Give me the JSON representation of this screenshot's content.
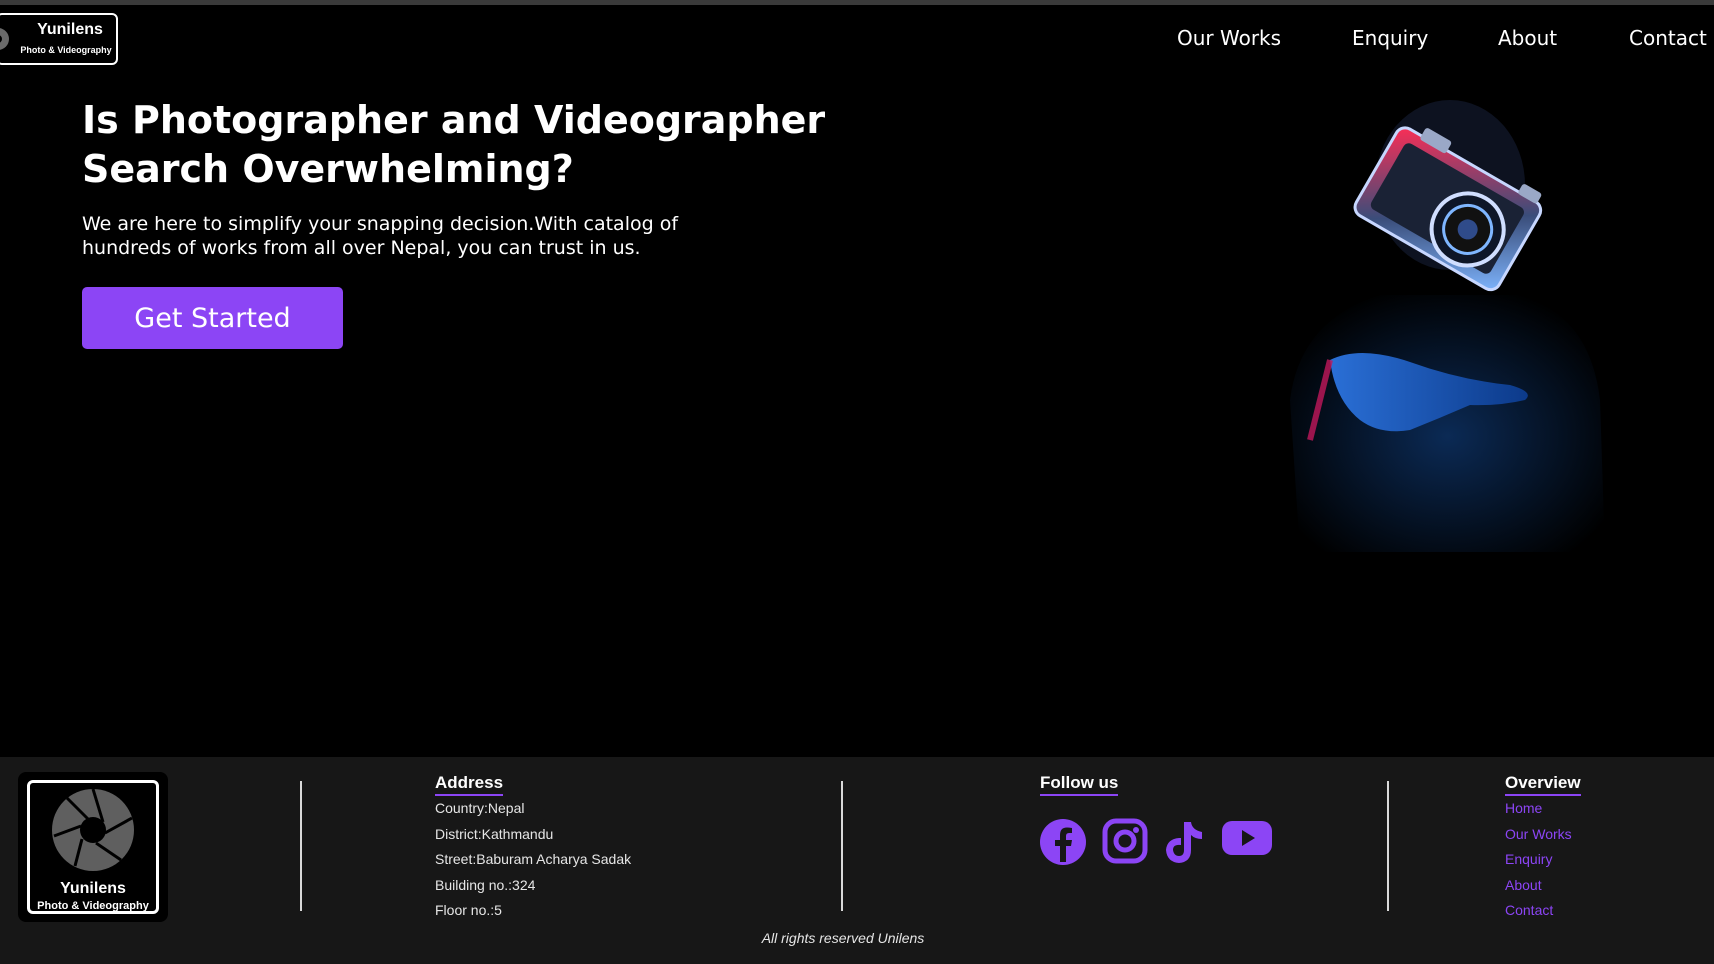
{
  "brand": {
    "name": "Yunilens",
    "tagline": "Photo & Videography"
  },
  "nav": {
    "items": [
      {
        "label": "Our Works"
      },
      {
        "label": "Enquiry"
      },
      {
        "label": "About"
      },
      {
        "label": "Contact"
      }
    ]
  },
  "hero": {
    "title": "Is Photographer and Videographer Search Overwhelming?",
    "text": "We are here to simplify your snapping decision.With catalog of hundreds of works from all over Nepal, you can trust in us.",
    "cta_label": "Get Started",
    "image_alt": "Person holding a floating vintage camera in neon light"
  },
  "footer": {
    "address": {
      "title": "Address",
      "lines": [
        "Country:Nepal",
        "District:Kathmandu",
        "Street:Baburam Acharya Sadak",
        "Building no.:324",
        "Floor no.:5"
      ]
    },
    "follow": {
      "title": "Follow us",
      "icons": [
        "facebook-icon",
        "instagram-icon",
        "tiktok-icon",
        "youtube-icon"
      ]
    },
    "overview": {
      "title": "Overview",
      "links": [
        "Home",
        "Our Works",
        "Enquiry",
        "About",
        "Contact"
      ]
    },
    "copyright": "All rights reserved Unilens"
  },
  "colors": {
    "accent": "#8c45f5",
    "background": "#000000",
    "footer_bg": "#171717"
  }
}
